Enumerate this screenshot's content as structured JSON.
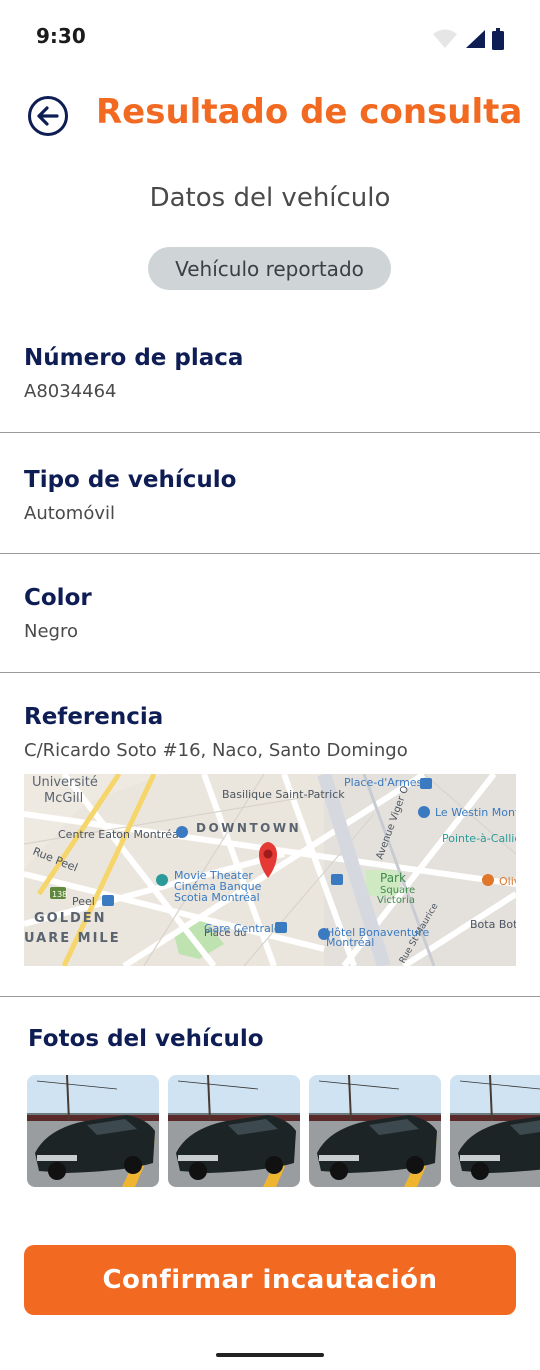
{
  "status": {
    "time": "9:30"
  },
  "header": {
    "title": "Resultado de consulta"
  },
  "section_title": "Datos del vehículo",
  "badge": "Vehículo reportado",
  "fields": [
    {
      "label": "Número de placa",
      "value": "A8034464"
    },
    {
      "label": "Tipo de vehículo",
      "value": "Automóvil"
    },
    {
      "label": "Color",
      "value": "Negro"
    },
    {
      "label": "Referencia",
      "value": "C/Ricardo Soto #16, Naco, Santo Domingo"
    }
  ],
  "map_labels": {
    "universite": "Université",
    "mcgill": "McGill",
    "basilique": "Basilique Saint-Patrick",
    "place_darmes": "Place-d'Armes",
    "le_westin": "Le Westin Mont",
    "downtown": "DOWNTOWN",
    "centre_eaton": "Centre Eaton Montréal",
    "pointe": "Pointe-à-Callié",
    "rue_peel": "Rue Peel",
    "avenue_viger": "Avenue Viger O",
    "movie_theater": "Movie Theater",
    "cinema": "Cinéma Banque",
    "scotia": "Scotia Montréal",
    "park": "Park",
    "square": "Square",
    "victoria": "Victoria",
    "olive": "Oliv",
    "peel_m": "Peel",
    "route": "138",
    "golden": "GOLDEN",
    "square_mile": "UARE MILE",
    "gare_centrale": "Gare Centrale",
    "hotel_bonaventure": "Hôtel Bonaventure",
    "montreal": "Montréal",
    "bota": "Bota Bota",
    "place_du": "Place du",
    "rue_st_maurice": "Rue St Maurice"
  },
  "photos": {
    "title": "Fotos del vehículo"
  },
  "confirm_label": "Confirmar incautación"
}
